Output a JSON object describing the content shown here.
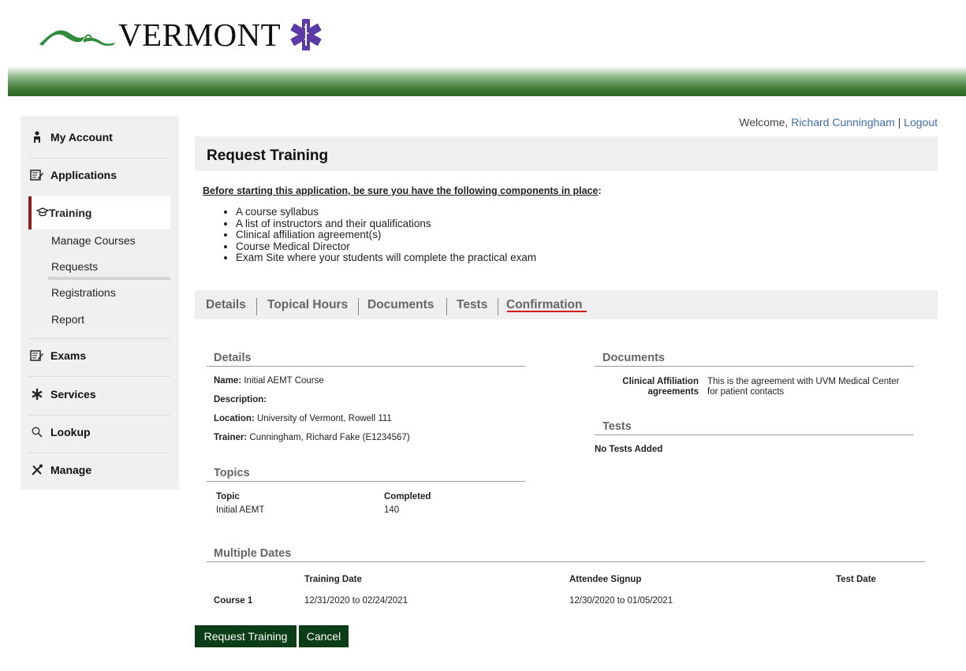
{
  "brand": {
    "logo_text": "VERMONT"
  },
  "user": {
    "welcome_prefix": "Welcome, ",
    "name": "Richard Cunningham",
    "separator": " | ",
    "logout": "Logout"
  },
  "sidebar": {
    "my_account": "My Account",
    "applications": "Applications",
    "training": "Training",
    "training_sub": [
      "Manage Courses",
      "Requests",
      "Registrations",
      "Report"
    ],
    "exams": "Exams",
    "services": "Services",
    "lookup": "Lookup",
    "manage": "Manage"
  },
  "page": {
    "title": "Request Training",
    "intro": "Before starting this application, be sure you have the following components in place",
    "intro_colon": ":",
    "bullets": [
      "A course syllabus",
      "A list of instructors and their qualifications",
      "Clinical affiliation agreement(s)",
      "Course Medical Director",
      "Exam Site where your students will complete the practical exam"
    ]
  },
  "tabs": [
    "Details",
    "Topical Hours",
    "Documents",
    "Tests",
    "Confirmation"
  ],
  "details": {
    "title": "Details",
    "name_label": "Name:",
    "name_value": "Initial AEMT Course",
    "description_label": "Description:",
    "location_label": "Location:",
    "location_value": "University of Vermont, Rowell 111",
    "trainer_label": "Trainer:",
    "trainer_value": "Cunningham, Richard Fake (E1234567)"
  },
  "documents": {
    "title": "Documents",
    "label_line1": "Clinical Affiliation",
    "label_line2": "agreements",
    "value_line1": "This is the agreement with UVM Medical Center",
    "value_line2": "for patient contacts"
  },
  "tests": {
    "title": "Tests",
    "empty": "No Tests Added"
  },
  "topics": {
    "title": "Topics",
    "headers": [
      "Topic",
      "Completed"
    ],
    "rows": [
      [
        "Initial AEMT",
        "140"
      ]
    ]
  },
  "multiple_dates": {
    "title": "Multiple Dates",
    "headers": [
      "Training Date",
      "Attendee Signup",
      "Test Date"
    ],
    "row_label": "Course 1",
    "training_date": "12/31/2020 to 02/24/2021",
    "attendee_signup": "12/30/2020 to 01/05/2021",
    "test_date": ""
  },
  "buttons": {
    "request": "Request Training",
    "cancel": "Cancel"
  },
  "colors": {
    "accent_green": "#0b3d17",
    "active_tab": "#d0191b",
    "sidebar_active": "#8b1e1e",
    "link": "#3f6eaa"
  }
}
